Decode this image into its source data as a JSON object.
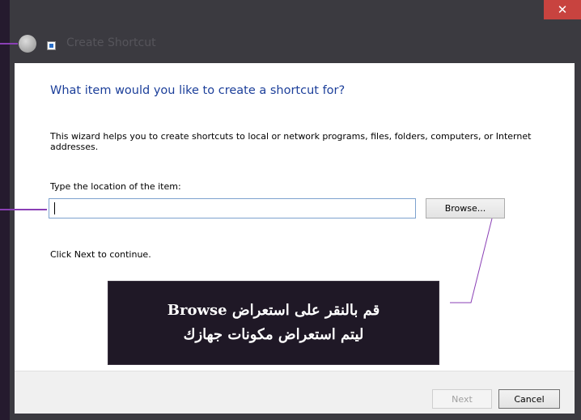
{
  "window": {
    "title": "Create Shortcut",
    "close_glyph": "✕",
    "icons": {
      "back": "back-arrow-icon",
      "title": "shortcut-icon",
      "close": "close-icon"
    }
  },
  "wizard": {
    "heading": "What item would you like to create a shortcut for?",
    "intro": "This wizard helps you to create shortcuts to local or network programs, files, folders, computers, or Internet addresses.",
    "location_label": "Type the location of the item:",
    "location_value": "",
    "browse_label": "Browse...",
    "continue_text": "Click Next to continue."
  },
  "footer": {
    "next_label": "Next",
    "cancel_label": "Cancel"
  },
  "annotation": {
    "line1": "قم بالنقر على استعراض Browse",
    "line2": "ليتم استعراض مكونات جهازك",
    "accent_color": "#8a3fb5"
  },
  "colors": {
    "heading": "#1c3f9a",
    "close_button": "#c8433f",
    "frame": "#3b3a40"
  }
}
